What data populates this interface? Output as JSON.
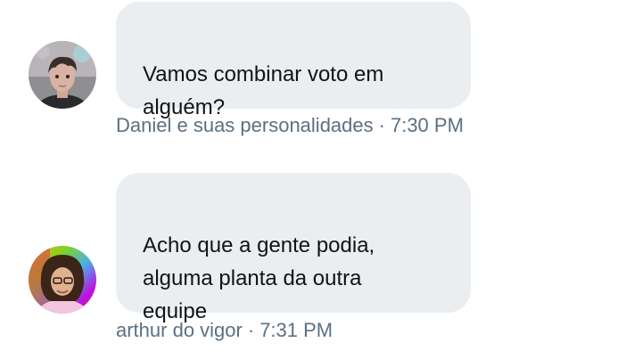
{
  "messages": [
    {
      "text": "Vamos combinar voto em\nalguém?",
      "sender": "Daniel e suas personalidades",
      "separator": "·",
      "time": "7:30 PM",
      "avatar_icon": "avatar-daniel"
    },
    {
      "text": "Acho que a gente podia,\nalguma planta da outra\nequipe",
      "sender": "arthur do vigor",
      "separator": "·",
      "time": "7:31 PM",
      "avatar_icon": "avatar-arthur"
    }
  ],
  "colors": {
    "bubble": "#ebeef1",
    "text": "#0f1419",
    "meta": "#5b7083"
  }
}
